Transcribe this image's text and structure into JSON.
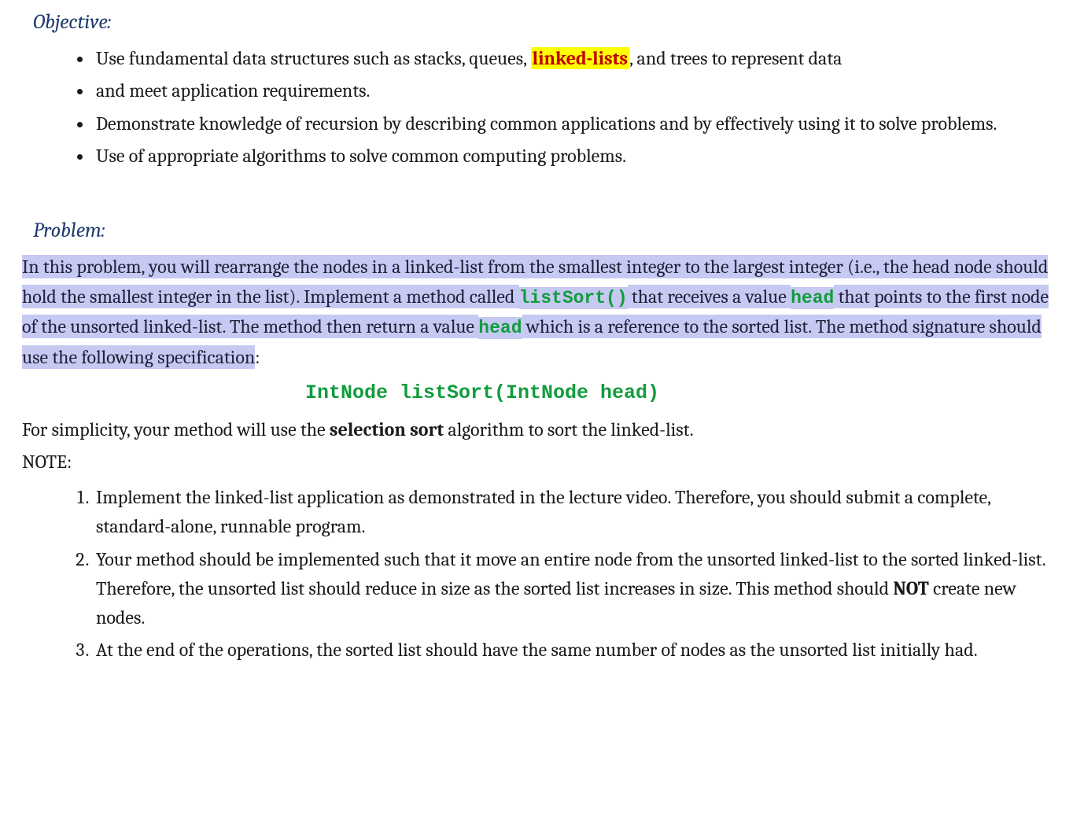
{
  "headings": {
    "objective": "Objective:",
    "problem": "Problem:"
  },
  "objectives": {
    "item1": {
      "pre": "Use fundamental data structures such as stacks, queues, ",
      "highlight": "linked-lists",
      "post": ", and trees to represent data"
    },
    "item2": "and meet application requirements.",
    "item3": "Demonstrate knowledge of recursion by describing common applications and by effectively using it to solve problems.",
    "item4": "Use of appropriate algorithms to solve common computing problems."
  },
  "problem": {
    "seg1": "In this problem, you will rearrange the nodes in a linked-list from the smallest integer to the largest integer (i.e., the head node should hold the smallest integer in the list). Implement a method called ",
    "code1": "listSort()",
    "seg2": " that receives a value ",
    "code2": "head",
    "seg3": " that points to the first node of the unsorted linked-list. The method then return a value ",
    "code3": "head",
    "seg4": " which is a reference to the sorted list. The method signature should use the following specification",
    "trailing": ":",
    "signature": "IntNode listSort(IntNode head)",
    "simplicity_pre": "For simplicity, your method will use the ",
    "simplicity_bold": "selection sort",
    "simplicity_post": " algorithm to sort the linked-list.",
    "note_label": "NOTE:",
    "notes": {
      "n1": "Implement the linked-list application as demonstrated in the lecture video. Therefore, you should submit a complete, standard-alone, runnable program.",
      "n2_pre": "Your method should be implemented such that it move an entire node from the unsorted linked-list to the sorted linked-list. Therefore, the unsorted list should reduce in size as the sorted list increases in size. This method should ",
      "n2_bold": "NOT",
      "n2_post": " create new nodes.",
      "n3": "At the end of the operations, the sorted list should have the same number of nodes as the unsorted list initially had."
    }
  }
}
